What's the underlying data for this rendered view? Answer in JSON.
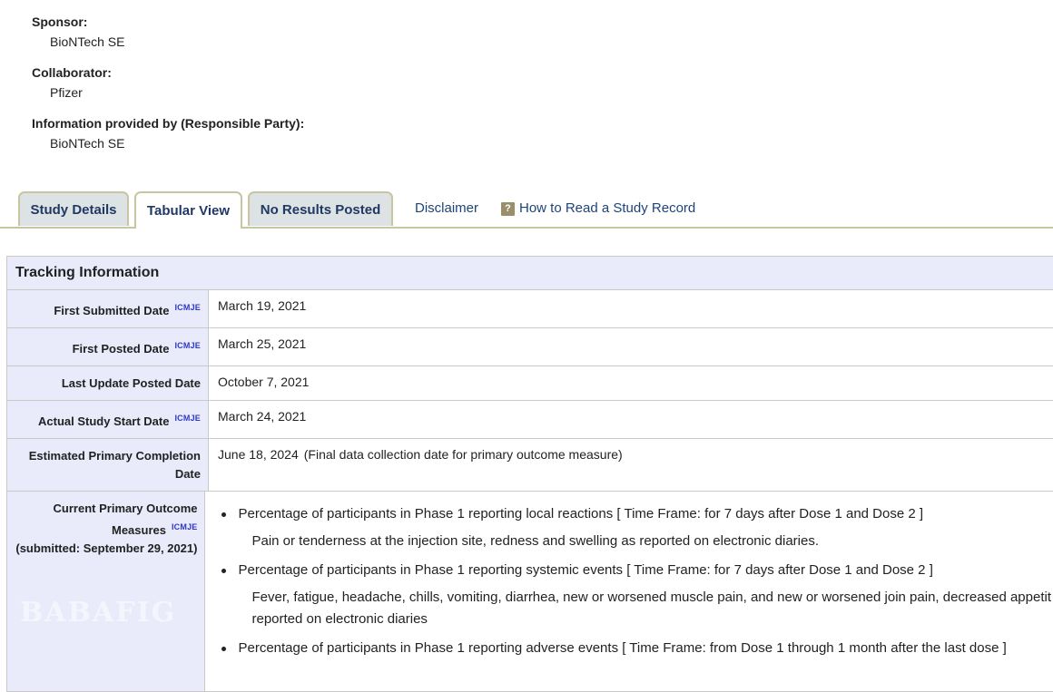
{
  "sponsor": {
    "label": "Sponsor:",
    "value": "BioNTech SE"
  },
  "collaborator": {
    "label": "Collaborator:",
    "value": "Pfizer"
  },
  "responsible": {
    "label": "Information provided by (Responsible Party):",
    "value": "BioNTech SE"
  },
  "tabs": {
    "study_details": "Study Details",
    "tabular_view": "Tabular View",
    "no_results": "No Results Posted",
    "disclaimer": "Disclaimer",
    "how_to_read": "How to Read a Study Record",
    "help_icon_glyph": "?"
  },
  "table": {
    "title": "Tracking Information",
    "icmje": "ICMJE",
    "rows": [
      {
        "label": "First Submitted Date",
        "value": "March 19, 2021"
      },
      {
        "label": "First Posted Date",
        "value": "March 25, 2021"
      },
      {
        "label": "Last Update Posted Date",
        "value": "October 7, 2021"
      },
      {
        "label": "Actual Study Start Date",
        "value": "March 24, 2021"
      },
      {
        "label": "Estimated Primary Completion Date",
        "value": "June 18, 2024",
        "note": "(Final data collection date for primary outcome measure)"
      }
    ],
    "outcomes": {
      "label": "Current Primary Outcome Measures",
      "submitted": "(submitted: September 29, 2021)",
      "items": [
        {
          "text": "Percentage of participants in Phase 1 reporting local reactions [ Time Frame: for 7 days after Dose 1 and Dose 2 ]",
          "desc": "Pain or tenderness at the injection site, redness and swelling as reported on electronic diaries."
        },
        {
          "text": "Percentage of participants in Phase 1 reporting systemic events [ Time Frame: for 7 days after Dose 1 and Dose 2 ]",
          "desc": "Fever, fatigue, headache, chills, vomiting, diarrhea, new or worsened muscle pain, and new or worsened join pain, decreased appetit",
          "desc2": "reported on electronic diaries"
        },
        {
          "text": "Percentage of participants in Phase 1 reporting adverse events [ Time Frame: from Dose 1 through 1 month after the last dose ]"
        }
      ]
    }
  },
  "watermark": "BABAFIG"
}
